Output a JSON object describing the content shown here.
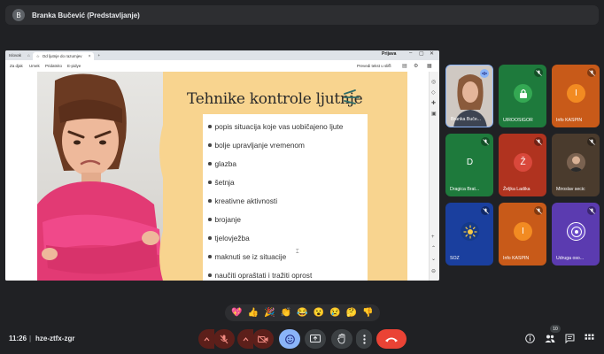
{
  "presenter": {
    "initial": "B",
    "name": "Branka Bučević (Predstavljanje)"
  },
  "browser": {
    "tabs": [
      "Islovak",
      "Od ljutnje do razumjev"
    ],
    "login": "Prijava",
    "menu": [
      "Za djak",
      "Umek",
      "Pridatnito",
      "E-pidye"
    ],
    "reading_mode": "Prevedi tekst u slici"
  },
  "slide": {
    "title": "Tehnike kontrole ljutnje",
    "items": [
      "popis situacija koje vas uobičajeno ljute",
      "bolje upravljanje vremenom",
      "glazba",
      "šetnja",
      "kreativne aktivnosti",
      "brojanje",
      "tjelovježba",
      "maknuti se iz situacije",
      "naučiti opraštati i tražiti oprost"
    ]
  },
  "participants": [
    {
      "label": "Branka Buče...",
      "type": "photo",
      "bg": "#c9c3be",
      "speaking": true
    },
    {
      "label": "UIROOSIGOR",
      "type": "icon",
      "bg": "#1e7a3c",
      "avatar_bg": "#34a853",
      "icon": "lock-icon"
    },
    {
      "label": "Info KASPIN",
      "type": "letter",
      "letter": "I",
      "bg": "#c85a19",
      "avatar_bg": "#f28b22"
    },
    {
      "label": "Dragica Brat...",
      "type": "letter",
      "letter": "D",
      "bg": "#1e7a3c",
      "avatar_bg": "#1e7a3c"
    },
    {
      "label": "Željka Ladika",
      "type": "letter",
      "letter": "Ž",
      "bg": "#b0331f",
      "avatar_bg": "#d9483b"
    },
    {
      "label": "Miroslav secic",
      "type": "photo",
      "bg": "#4a3b2d",
      "avatar_bg": "#6b5646"
    },
    {
      "label": "SOZ",
      "type": "icon",
      "bg": "#1a3f9e",
      "avatar_bg": "#153a8a",
      "icon": "sun-logo-icon"
    },
    {
      "label": "Info KASPIN",
      "type": "letter",
      "letter": "I",
      "bg": "#c85a19",
      "avatar_bg": "#f28b22"
    },
    {
      "label": "Udruga oso...",
      "type": "icon",
      "bg": "#5b3bb0",
      "avatar_bg": "#6b4cc7",
      "icon": "org-logo-icon"
    }
  ],
  "reactions": [
    "💖",
    "👍",
    "🎉",
    "👏",
    "😂",
    "😮",
    "😢",
    "🤔",
    "👎"
  ],
  "meeting": {
    "time": "11:26",
    "separator": "|",
    "code": "hze-ztfx-zgr",
    "participant_count": "10"
  },
  "colors": {
    "mute_red": "#5c1f1a",
    "end_call": "#ea4335",
    "emoji_blue": "#8ab4f8"
  }
}
